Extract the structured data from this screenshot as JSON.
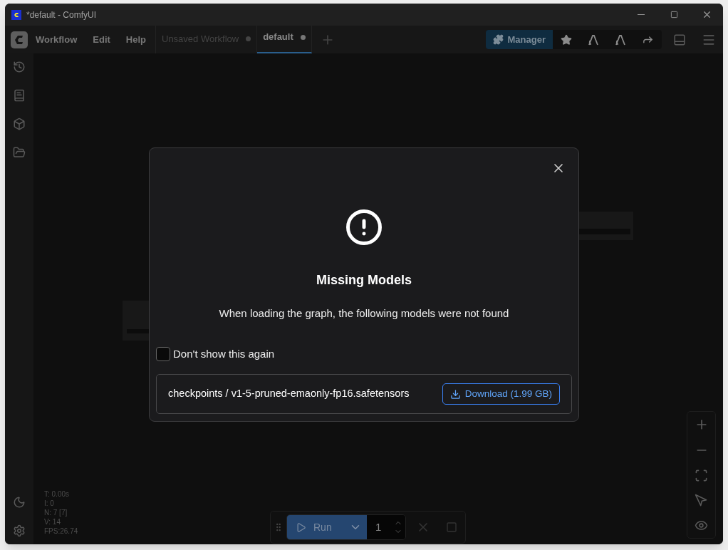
{
  "window": {
    "title": "*default - ComfyUI"
  },
  "menu": [
    "Workflow",
    "Edit",
    "Help"
  ],
  "tabs": [
    {
      "label": "Unsaved Workflow",
      "selected": false,
      "modified": true
    },
    {
      "label": "default",
      "selected": true,
      "modified": true
    }
  ],
  "toolbar": {
    "manager": "Manager"
  },
  "stats": [
    "T: 0.00s",
    "I: 0",
    "N: 7 [7]",
    "V: 14",
    "FPS:26.74"
  ],
  "run_bar": {
    "run": "Run",
    "batch_count": "1"
  },
  "dialog": {
    "title": "Missing Models",
    "message": "When loading the graph, the following models were not found",
    "checkbox": {
      "label": "Don't show this again",
      "checked": false
    },
    "models": [
      {
        "path": "checkpoints / v1-5-pruned-emaonly-fp16.safetensors",
        "download": "Download (1.99 GB)"
      }
    ]
  }
}
